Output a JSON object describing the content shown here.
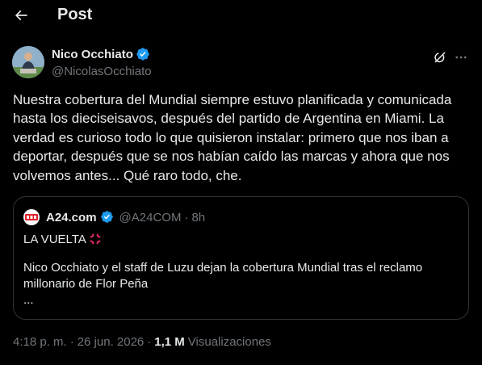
{
  "header": {
    "title": "Post",
    "back_icon": "arrow-left-icon"
  },
  "author": {
    "display_name": "Nico Occhiato",
    "handle": "@NicolasOcchiato",
    "verified": true,
    "verified_color": "#1d9bf0"
  },
  "post": {
    "text": "Nuestra cobertura del Mundial siempre estuvo planificada y comunicada\nhasta los dieciseisavos, después del partido de Argentina en Miami. La\nverdad es curioso todo lo que quisieron instalar: primero que nos iban a\ndeportar, después que se nos habían caído las marcas y ahora que nos\nvolvemos antes... Qué raro todo, che."
  },
  "quote": {
    "display_name": "A24.com",
    "handle": "@A24COM",
    "separator": "·",
    "time": "8h",
    "verified": true,
    "headline": "LA VUELTA",
    "headline_icon": "anger-icon",
    "body": "Nico Occhiato y el staff de Luzu dejan la cobertura Mundial tras el reclamo\nmillonario de Flor Peña\n..."
  },
  "meta": {
    "time": "4:18 p. m.",
    "separator1": "·",
    "date": "26 jun. 2026",
    "separator2": "·",
    "views_count": "1,1 M",
    "views_label": "Visualizaciones"
  },
  "colors": {
    "background": "#000000",
    "text": "#e7e9ea",
    "muted": "#71767b",
    "border": "#2f3336",
    "accent": "#1d9bf0"
  }
}
